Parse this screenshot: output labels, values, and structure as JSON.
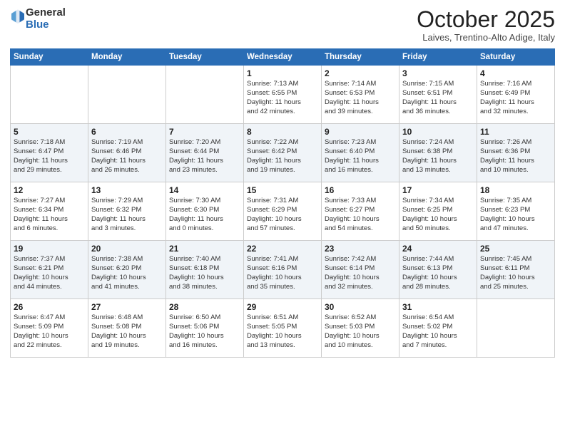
{
  "header": {
    "logo_general": "General",
    "logo_blue": "Blue",
    "month": "October 2025",
    "location": "Laives, Trentino-Alto Adige, Italy"
  },
  "days_of_week": [
    "Sunday",
    "Monday",
    "Tuesday",
    "Wednesday",
    "Thursday",
    "Friday",
    "Saturday"
  ],
  "weeks": [
    [
      {
        "day": "",
        "info": ""
      },
      {
        "day": "",
        "info": ""
      },
      {
        "day": "",
        "info": ""
      },
      {
        "day": "1",
        "info": "Sunrise: 7:13 AM\nSunset: 6:55 PM\nDaylight: 11 hours\nand 42 minutes."
      },
      {
        "day": "2",
        "info": "Sunrise: 7:14 AM\nSunset: 6:53 PM\nDaylight: 11 hours\nand 39 minutes."
      },
      {
        "day": "3",
        "info": "Sunrise: 7:15 AM\nSunset: 6:51 PM\nDaylight: 11 hours\nand 36 minutes."
      },
      {
        "day": "4",
        "info": "Sunrise: 7:16 AM\nSunset: 6:49 PM\nDaylight: 11 hours\nand 32 minutes."
      }
    ],
    [
      {
        "day": "5",
        "info": "Sunrise: 7:18 AM\nSunset: 6:47 PM\nDaylight: 11 hours\nand 29 minutes."
      },
      {
        "day": "6",
        "info": "Sunrise: 7:19 AM\nSunset: 6:46 PM\nDaylight: 11 hours\nand 26 minutes."
      },
      {
        "day": "7",
        "info": "Sunrise: 7:20 AM\nSunset: 6:44 PM\nDaylight: 11 hours\nand 23 minutes."
      },
      {
        "day": "8",
        "info": "Sunrise: 7:22 AM\nSunset: 6:42 PM\nDaylight: 11 hours\nand 19 minutes."
      },
      {
        "day": "9",
        "info": "Sunrise: 7:23 AM\nSunset: 6:40 PM\nDaylight: 11 hours\nand 16 minutes."
      },
      {
        "day": "10",
        "info": "Sunrise: 7:24 AM\nSunset: 6:38 PM\nDaylight: 11 hours\nand 13 minutes."
      },
      {
        "day": "11",
        "info": "Sunrise: 7:26 AM\nSunset: 6:36 PM\nDaylight: 11 hours\nand 10 minutes."
      }
    ],
    [
      {
        "day": "12",
        "info": "Sunrise: 7:27 AM\nSunset: 6:34 PM\nDaylight: 11 hours\nand 6 minutes."
      },
      {
        "day": "13",
        "info": "Sunrise: 7:29 AM\nSunset: 6:32 PM\nDaylight: 11 hours\nand 3 minutes."
      },
      {
        "day": "14",
        "info": "Sunrise: 7:30 AM\nSunset: 6:30 PM\nDaylight: 11 hours\nand 0 minutes."
      },
      {
        "day": "15",
        "info": "Sunrise: 7:31 AM\nSunset: 6:29 PM\nDaylight: 10 hours\nand 57 minutes."
      },
      {
        "day": "16",
        "info": "Sunrise: 7:33 AM\nSunset: 6:27 PM\nDaylight: 10 hours\nand 54 minutes."
      },
      {
        "day": "17",
        "info": "Sunrise: 7:34 AM\nSunset: 6:25 PM\nDaylight: 10 hours\nand 50 minutes."
      },
      {
        "day": "18",
        "info": "Sunrise: 7:35 AM\nSunset: 6:23 PM\nDaylight: 10 hours\nand 47 minutes."
      }
    ],
    [
      {
        "day": "19",
        "info": "Sunrise: 7:37 AM\nSunset: 6:21 PM\nDaylight: 10 hours\nand 44 minutes."
      },
      {
        "day": "20",
        "info": "Sunrise: 7:38 AM\nSunset: 6:20 PM\nDaylight: 10 hours\nand 41 minutes."
      },
      {
        "day": "21",
        "info": "Sunrise: 7:40 AM\nSunset: 6:18 PM\nDaylight: 10 hours\nand 38 minutes."
      },
      {
        "day": "22",
        "info": "Sunrise: 7:41 AM\nSunset: 6:16 PM\nDaylight: 10 hours\nand 35 minutes."
      },
      {
        "day": "23",
        "info": "Sunrise: 7:42 AM\nSunset: 6:14 PM\nDaylight: 10 hours\nand 32 minutes."
      },
      {
        "day": "24",
        "info": "Sunrise: 7:44 AM\nSunset: 6:13 PM\nDaylight: 10 hours\nand 28 minutes."
      },
      {
        "day": "25",
        "info": "Sunrise: 7:45 AM\nSunset: 6:11 PM\nDaylight: 10 hours\nand 25 minutes."
      }
    ],
    [
      {
        "day": "26",
        "info": "Sunrise: 6:47 AM\nSunset: 5:09 PM\nDaylight: 10 hours\nand 22 minutes."
      },
      {
        "day": "27",
        "info": "Sunrise: 6:48 AM\nSunset: 5:08 PM\nDaylight: 10 hours\nand 19 minutes."
      },
      {
        "day": "28",
        "info": "Sunrise: 6:50 AM\nSunset: 5:06 PM\nDaylight: 10 hours\nand 16 minutes."
      },
      {
        "day": "29",
        "info": "Sunrise: 6:51 AM\nSunset: 5:05 PM\nDaylight: 10 hours\nand 13 minutes."
      },
      {
        "day": "30",
        "info": "Sunrise: 6:52 AM\nSunset: 5:03 PM\nDaylight: 10 hours\nand 10 minutes."
      },
      {
        "day": "31",
        "info": "Sunrise: 6:54 AM\nSunset: 5:02 PM\nDaylight: 10 hours\nand 7 minutes."
      },
      {
        "day": "",
        "info": ""
      }
    ]
  ]
}
